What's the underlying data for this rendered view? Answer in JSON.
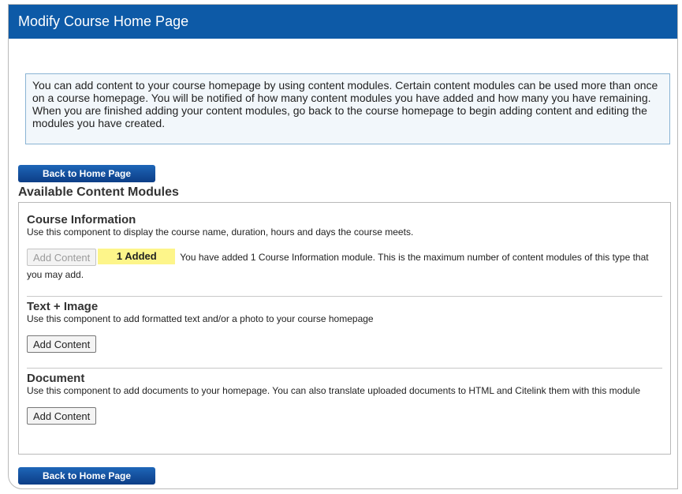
{
  "page": {
    "title": "Modify Course Home Page",
    "intro": "You can add content to your course homepage by using content modules. Certain content modules can be used more than once on a course homepage. You will be notified of how many content modules you have added and how many you have remaining. When you are finished adding your content modules, go back to the course homepage to begin adding content and editing the modules you have created.",
    "back_label": "Back to Home Page",
    "section_heading": "Available Content Modules"
  },
  "modules": [
    {
      "title": "Course Information",
      "description": "Use this component to display the course name, duration, hours and days the course meets.",
      "button_label": "Add Content",
      "disabled": true,
      "badge": "1 Added",
      "status": "You have added 1 Course Information module. This is the maximum number of content modules of this type that you may add."
    },
    {
      "title": "Text + Image",
      "description": "Use this component to add formatted text and/or a photo to your course homepage",
      "button_label": "Add Content",
      "disabled": false
    },
    {
      "title": "Document",
      "description": "Use this component to add documents to your homepage. You can also translate uploaded documents to HTML and Citelink them with this module",
      "button_label": "Add Content",
      "disabled": false
    }
  ],
  "colors": {
    "title_bar": "#0d5aa7",
    "button": "#0c3d86",
    "badge": "#fdf58a",
    "info_box_bg": "#f2f7fb",
    "info_box_border": "#8ab3d4"
  }
}
